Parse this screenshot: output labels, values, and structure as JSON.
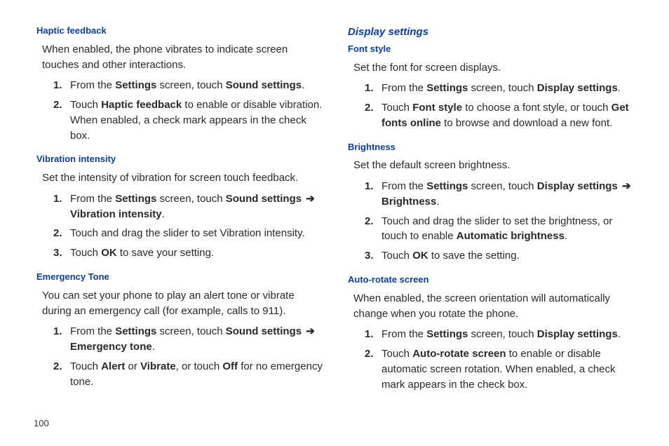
{
  "pageNumber": "100",
  "arrow": "➔",
  "left": {
    "haptic": {
      "head": "Haptic feedback",
      "intro": "When enabled, the phone vibrates to indicate screen touches and other interactions.",
      "step1_a": "From the ",
      "step1_b": "Settings",
      "step1_c": " screen, touch ",
      "step1_d": "Sound settings",
      "step1_e": ".",
      "step2_a": "Touch ",
      "step2_b": "Haptic feedback",
      "step2_c": " to enable or disable vibration. When enabled, a check mark appears in the check box."
    },
    "vibration": {
      "head": "Vibration intensity",
      "intro": "Set the intensity of vibration for screen touch feedback.",
      "step1_a": "From the ",
      "step1_b": "Settings",
      "step1_c": " screen, touch ",
      "step1_d": "Sound settings",
      "step1_e": " ",
      "step1_f": "Vibration intensity",
      "step1_g": ".",
      "step2": "Touch and drag the slider to set Vibration intensity.",
      "step3_a": "Touch ",
      "step3_b": "OK",
      "step3_c": " to save your setting."
    },
    "emergency": {
      "head": "Emergency Tone",
      "intro": "You can set your phone to play an alert tone or vibrate during an emergency call (for example, calls to 911).",
      "step1_a": "From the ",
      "step1_b": "Settings",
      "step1_c": " screen, touch ",
      "step1_d": "Sound settings",
      "step1_e": " ",
      "step1_f": "Emergency tone",
      "step1_g": ".",
      "step2_a": "Touch ",
      "step2_b": "Alert",
      "step2_c": " or ",
      "step2_d": "Vibrate",
      "step2_e": ", or touch ",
      "step2_f": "Off",
      "step2_g": " for no emergency tone."
    }
  },
  "right": {
    "display": {
      "head": "Display settings"
    },
    "font": {
      "head": "Font style",
      "intro": "Set the font for screen displays.",
      "step1_a": "From the ",
      "step1_b": "Settings",
      "step1_c": " screen, touch ",
      "step1_d": "Display settings",
      "step1_e": ".",
      "step2_a": "Touch ",
      "step2_b": "Font style",
      "step2_c": " to choose a font style, or touch ",
      "step2_d": "Get fonts online",
      "step2_e": " to browse and download a new font."
    },
    "brightness": {
      "head": "Brightness",
      "intro": "Set the default screen brightness.",
      "step1_a": "From the ",
      "step1_b": "Settings",
      "step1_c": " screen, touch ",
      "step1_d": "Display settings",
      "step1_e": " ",
      "step1_f": "Brightness",
      "step1_g": ".",
      "step2_a": "Touch and drag the slider to set the brightness, or touch to enable ",
      "step2_b": "Automatic brightness",
      "step2_c": ".",
      "step3_a": "Touch ",
      "step3_b": "OK",
      "step3_c": " to save the setting."
    },
    "rotate": {
      "head": "Auto-rotate screen",
      "intro": "When enabled, the screen orientation will automatically change when you rotate the phone.",
      "step1_a": "From the ",
      "step1_b": "Settings",
      "step1_c": " screen, touch ",
      "step1_d": "Display settings",
      "step1_e": ".",
      "step2_a": "Touch ",
      "step2_b": "Auto-rotate screen",
      "step2_c": " to enable or disable automatic screen rotation. When enabled, a check mark appears in the check box."
    }
  }
}
